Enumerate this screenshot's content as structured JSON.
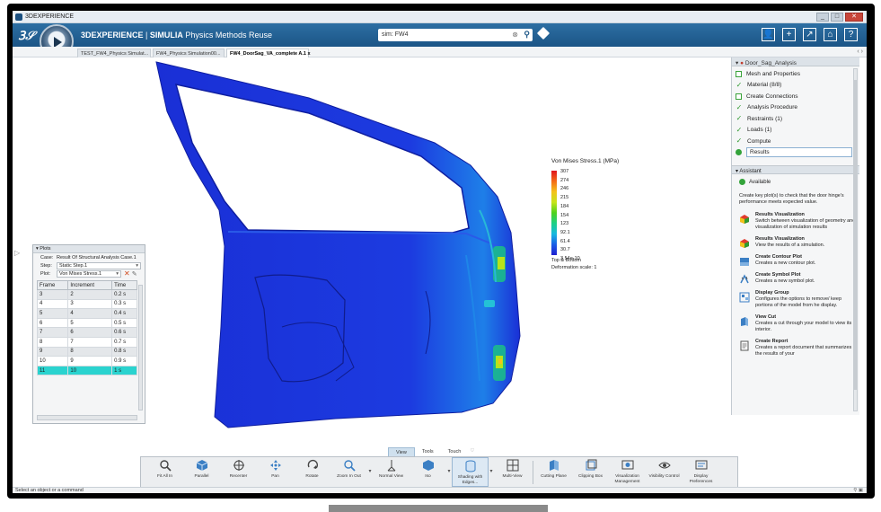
{
  "window": {
    "title": "3DEXPERIENCE",
    "controls": [
      "_",
      "□",
      "✕"
    ]
  },
  "header": {
    "brand": "3DEXPERIENCE",
    "separator": "|",
    "product": "SIMULIA",
    "app": "Physics Methods Reuse",
    "search_value": "sim: FW4",
    "icons": [
      "user-icon",
      "add-icon",
      "share-icon",
      "home-icon",
      "help-icon"
    ],
    "icon_glyphs": [
      "👤",
      "+",
      "↗",
      "⌂",
      "?"
    ]
  },
  "tabs": [
    {
      "label": "TEST_FW4_Physics Simulat..."
    },
    {
      "label": "FW4_Physics Simulation00..."
    },
    {
      "label": "FW4_DoorSag_VA_complete A.1",
      "active": true,
      "close": "x"
    }
  ],
  "legend": {
    "title": "Von Mises Stress.1 (MPa)",
    "values": [
      "307",
      "274",
      "246",
      "215",
      "184",
      "154",
      "123",
      "92.1",
      "61.4",
      "30.7",
      "3.54e-10"
    ],
    "footer1": "Top & Bottom",
    "footer2": "Deformation scale: 1"
  },
  "plots": {
    "title": "Plots",
    "case_label": "Case:",
    "case_value": "Result Of Structural Analysis Case.1",
    "step_label": "Step:",
    "step_value": "Static Step.1",
    "plot_label": "Plot:",
    "plot_value": "Von Mises Stress.1",
    "columns": [
      "Frame",
      "Increment",
      "Time"
    ],
    "rows": [
      [
        "3",
        "2",
        "0.2 s"
      ],
      [
        "4",
        "3",
        "0.3 s"
      ],
      [
        "5",
        "4",
        "0.4 s"
      ],
      [
        "6",
        "5",
        "0.5 s"
      ],
      [
        "7",
        "6",
        "0.6 s"
      ],
      [
        "8",
        "7",
        "0.7 s"
      ],
      [
        "9",
        "8",
        "0.8 s"
      ],
      [
        "10",
        "9",
        "0.9 s"
      ],
      [
        "11",
        "10",
        "1 s"
      ]
    ],
    "selected_frame": "11"
  },
  "panel": {
    "title": "Door_Sag_Analysis",
    "steps": [
      {
        "label": "Mesh and Properties",
        "state": "box"
      },
      {
        "label": "Material (8/8)",
        "state": "check"
      },
      {
        "label": "Create Connections",
        "state": "box"
      },
      {
        "label": "Analysis Procedure",
        "state": "check"
      },
      {
        "label": "Restraints (1)",
        "state": "check"
      },
      {
        "label": "Loads (1)",
        "state": "check"
      },
      {
        "label": "Compute",
        "state": "check"
      },
      {
        "label": "Results",
        "state": "dot"
      }
    ],
    "assistant_title": "Assistant",
    "available": "Available",
    "description": "Create key plot(s) to check that the door hinge's performance meets expected value.",
    "actions": [
      {
        "title": "Results Visualization",
        "desc": "Switch between visualization of geometry and visualization of simulation results",
        "icon": "results-visualization-icon"
      },
      {
        "title": "Results Visualization",
        "desc": "View the results of a simulation.",
        "icon": "results-visualization-icon"
      },
      {
        "title": "Create Contour Plot",
        "desc": "Creates a new contour plot.",
        "icon": "contour-plot-icon"
      },
      {
        "title": "Create Symbol Plot",
        "desc": "Creates a new symbol plot.",
        "icon": "symbol-plot-icon"
      },
      {
        "title": "Display Group",
        "desc": "Configures the options to remove/ keep portions of the model from he display.",
        "icon": "display-group-icon"
      },
      {
        "title": "View Cut",
        "desc": "Creates a cut through your model to view its interior.",
        "icon": "view-cut-icon"
      },
      {
        "title": "Create Report",
        "desc": "Creates a report document that summarizes the results of your",
        "icon": "report-icon"
      }
    ]
  },
  "section_tabs": [
    "View",
    "Tools",
    "Touch"
  ],
  "toolbar": [
    {
      "label": "Fit All In",
      "icon": "fit-all-icon"
    },
    {
      "label": "Parallel",
      "icon": "parallel-icon"
    },
    {
      "label": "Recenter",
      "icon": "recenter-icon"
    },
    {
      "label": "Pan",
      "icon": "pan-icon"
    },
    {
      "label": "Rotate",
      "icon": "rotate-icon"
    },
    {
      "label": "Zoom In Out",
      "icon": "zoom-icon"
    },
    {
      "label": "Normal View",
      "icon": "normal-view-icon"
    },
    {
      "label": "Iso",
      "icon": "iso-icon"
    },
    {
      "label": "Shading with Edges...",
      "icon": "shading-icon",
      "selected": true
    },
    {
      "label": "Multi-View",
      "icon": "multi-view-icon"
    },
    {
      "label": "Cutting Plane",
      "icon": "cutting-plane-icon"
    },
    {
      "label": "Clipping Box",
      "icon": "clipping-box-icon"
    },
    {
      "label": "Visualization Management",
      "icon": "visualization-management-icon"
    },
    {
      "label": "Visibility Control",
      "icon": "visibility-control-icon"
    },
    {
      "label": "Display Preferences",
      "icon": "display-preferences-icon"
    }
  ],
  "status": {
    "text": "Select an object or a command"
  },
  "colors": {
    "header": "#1b5586",
    "highlight": "#2ad3cf",
    "model": "#1a2fd6"
  }
}
